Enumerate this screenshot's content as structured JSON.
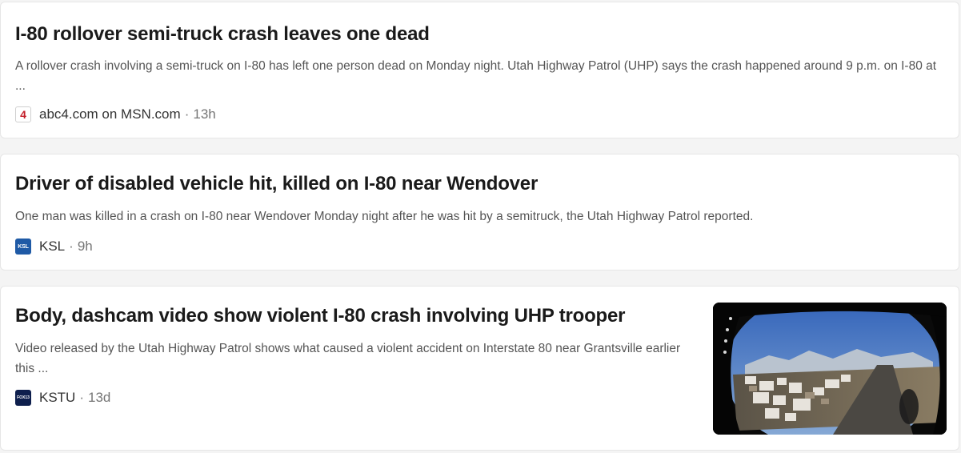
{
  "results": [
    {
      "title": "I-80 rollover semi-truck crash leaves one dead",
      "snippet": "A rollover crash involving a semi-truck on I-80 has left one person dead on Monday night. Utah Highway Patrol (UHP) says the crash happened around 9 p.m. on I-80 at ...",
      "source": "abc4.com on MSN.com",
      "age": "13h",
      "logo_text": "4",
      "logo_icon": "abc4-logo-icon"
    },
    {
      "title": "Driver of disabled vehicle hit, killed on I-80 near Wendover",
      "snippet": "One man was killed in a crash on I-80 near Wendover Monday night after he was hit by a semitruck, the Utah Highway Patrol reported.",
      "source": "KSL",
      "age": "9h",
      "logo_text": "KSL",
      "logo_icon": "ksl-logo-icon"
    },
    {
      "title": "Body, dashcam video show violent I-80 crash involving UHP trooper",
      "snippet": "Video released by the Utah Highway Patrol shows what caused a violent accident on Interstate 80 near Grantsville earlier this ...",
      "source": "KSTU",
      "age": "13d",
      "logo_text": "FOX13",
      "logo_icon": "fox13-logo-icon",
      "thumbnail": "dashcam-crash-thumbnail"
    }
  ],
  "separator": "·",
  "colors": {
    "title": "#1a1a1a",
    "snippet": "#555555",
    "meta": "#767676",
    "card_bg": "#ffffff",
    "page_bg": "#f4f4f4"
  }
}
